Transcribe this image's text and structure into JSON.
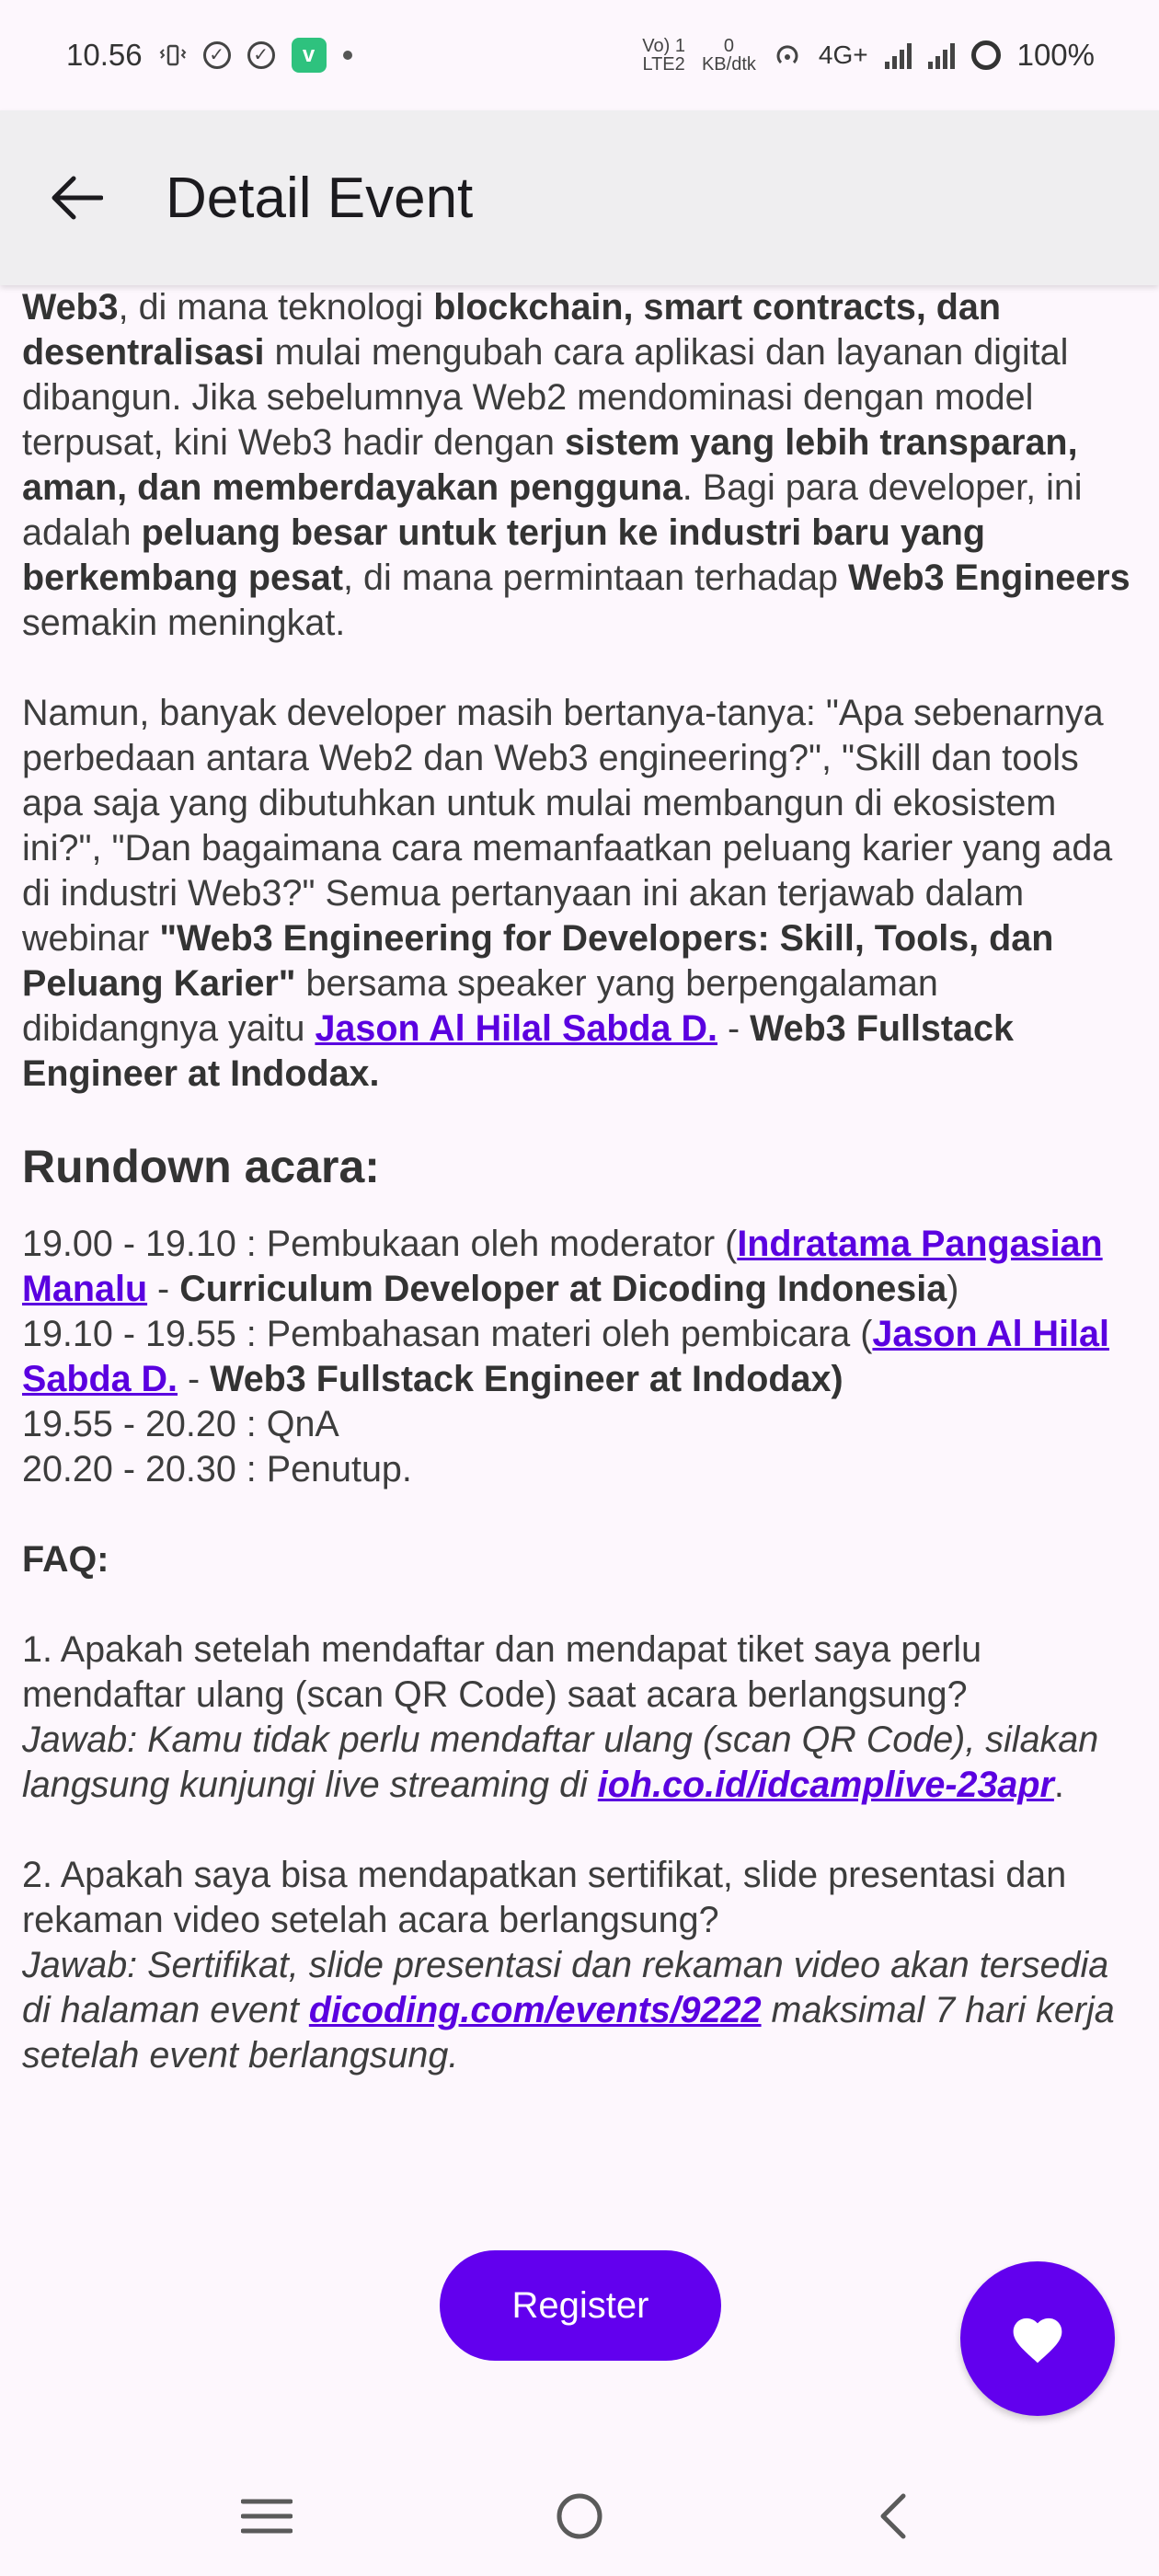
{
  "status_bar": {
    "time": "10.56",
    "network_label_top": "Vo) 1",
    "network_label_bottom": "LTE2",
    "speed_top": "0",
    "speed_bottom": "KB/dtk",
    "signal_label": "4G+",
    "battery": "100%"
  },
  "app_bar": {
    "title": "Detail Event"
  },
  "description": {
    "p1": {
      "a": "Web3",
      "b": ", di mana teknologi ",
      "c": "blockchain, smart contracts, dan desentralisasi",
      "d": " mulai mengubah cara aplikasi dan layanan digital dibangun. Jika sebelumnya Web2 mendominasi dengan model terpusat, kini Web3 hadir dengan ",
      "e": "sistem yang lebih transparan, aman, dan memberdayakan pengguna",
      "f": ". Bagi para developer, ini adalah ",
      "g": "peluang besar untuk terjun ke industri baru yang berkembang pesat",
      "h": ", di mana permintaan terhadap ",
      "i": "Web3 Engineers",
      "j": " semakin meningkat."
    },
    "p2": {
      "a": "Namun, banyak developer masih bertanya-tanya: \"Apa sebenarnya perbedaan antara Web2 dan Web3 engineering?\", \"Skill dan tools apa saja yang dibutuhkan untuk mulai membangun di ekosistem ini?\", \"Dan bagaimana cara memanfaatkan peluang karier yang ada di industri Web3?\" Semua pertanyaan ini akan terjawab dalam webinar ",
      "b": "\"Web3 Engineering for Developers: Skill, Tools, dan Peluang Karier\"",
      "c": " bersama speaker yang berpengalaman dibidangnya yaitu ",
      "link": "Jason Al Hilal Sabda D.",
      "d": " - ",
      "e": "Web3 Fullstack Engineer at Indodax."
    },
    "rundown_heading": "Rundown acara:",
    "rundown": {
      "r1a": "19.00 - 19.10 : Pembukaan oleh moderator (",
      "r1link": "Indratama Pangasian Manalu",
      "r1b": " - ",
      "r1c": "Curriculum Developer at Dicoding Indonesia",
      "r1d": ")",
      "r2a": "19.10 - 19.55 : Pembahasan materi oleh pembicara (",
      "r2link": "Jason Al Hilal Sabda D.",
      "r2b": " - ",
      "r2c": "Web3 Fullstack Engineer at Indodax)",
      "r3": "19.55 - 20.20 : QnA",
      "r4": "20.20 - 20.30 : Penutup."
    },
    "faq_heading": "FAQ:",
    "faq1": {
      "q": "1. Apakah setelah mendaftar dan mendapat tiket saya perlu mendaftar ulang (scan QR Code) saat acara berlangsung?",
      "a": "Jawab: Kamu tidak perlu mendaftar ulang (scan QR Code), silakan langsung kunjungi live streaming di ",
      "link": "ioh.co.id/idcamplive-23apr",
      "end": "."
    },
    "faq2": {
      "q": "2. Apakah saya bisa mendapatkan sertifikat, slide presentasi dan rekaman video setelah acara berlangsung?",
      "a": "Jawab: Sertifikat, slide presentasi dan rekaman video akan tersedia di halaman event ",
      "link": "dicoding.com/events/9222",
      "end": " maksimal 7 hari kerja setelah event berlangsung."
    }
  },
  "actions": {
    "register_label": "Register",
    "favorite_icon": "heart-icon"
  },
  "colors": {
    "accent": "#6200ee",
    "link": "#5a00e0",
    "app_bar_bg": "#efeef0",
    "page_bg": "#fdf7fd"
  }
}
